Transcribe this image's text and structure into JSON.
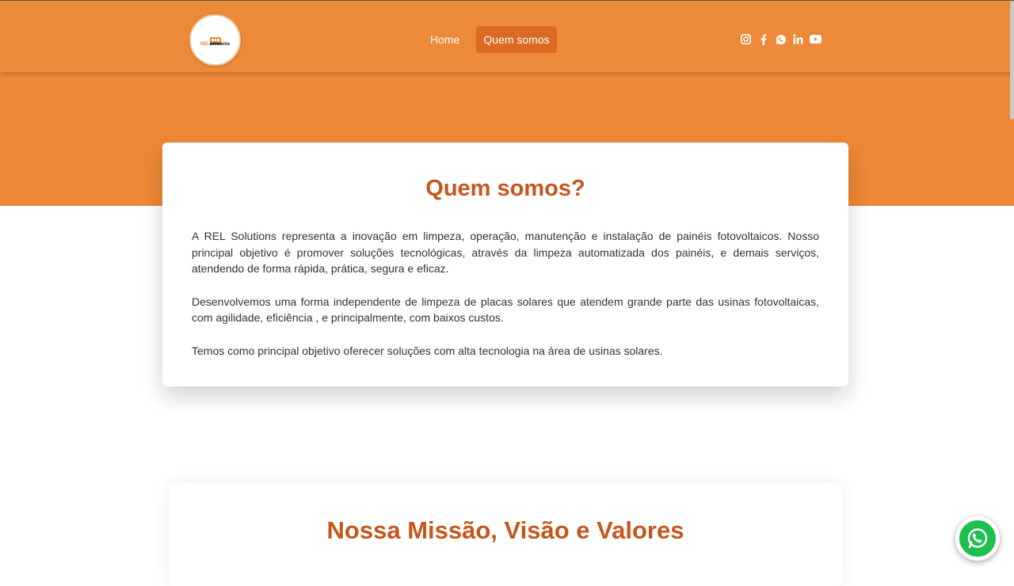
{
  "header": {
    "logo": {
      "prefix": "REL",
      "suffix": "Solutions"
    },
    "nav": [
      {
        "label": "Home",
        "active": false
      },
      {
        "label": "Quem somos",
        "active": true
      }
    ],
    "socials": [
      "instagram-icon",
      "facebook-icon",
      "whatsapp-icon",
      "linkedin-icon",
      "youtube-icon"
    ]
  },
  "about": {
    "title": "Quem somos?",
    "paragraphs": [
      "A REL Solutions representa a inovação em limpeza, operação, manutenção e instalação de painéis fotovoltaicos. Nosso principal objetivo é promover soluções tecnológicas, através da limpeza automatizada dos painéis, e demais serviços, atendendo de forma rápida, prática, segura e eficaz.",
      "Desenvolvemos uma forma independente de limpeza de placas solares que atendem grande parte das usinas fotovoltaicas, com agilidade, eficiência , e principalmente, com baixos custos.",
      "Temos como principal objetivo oferecer soluções com alta tecnologia na área de usinas solares."
    ]
  },
  "mission": {
    "title": "Nossa Missão, Visão e Valores"
  },
  "colors": {
    "header": "#ec8a39",
    "accent": "#c5561c",
    "active_nav": "#dc6a22",
    "whatsapp": "#1fbf4f"
  }
}
